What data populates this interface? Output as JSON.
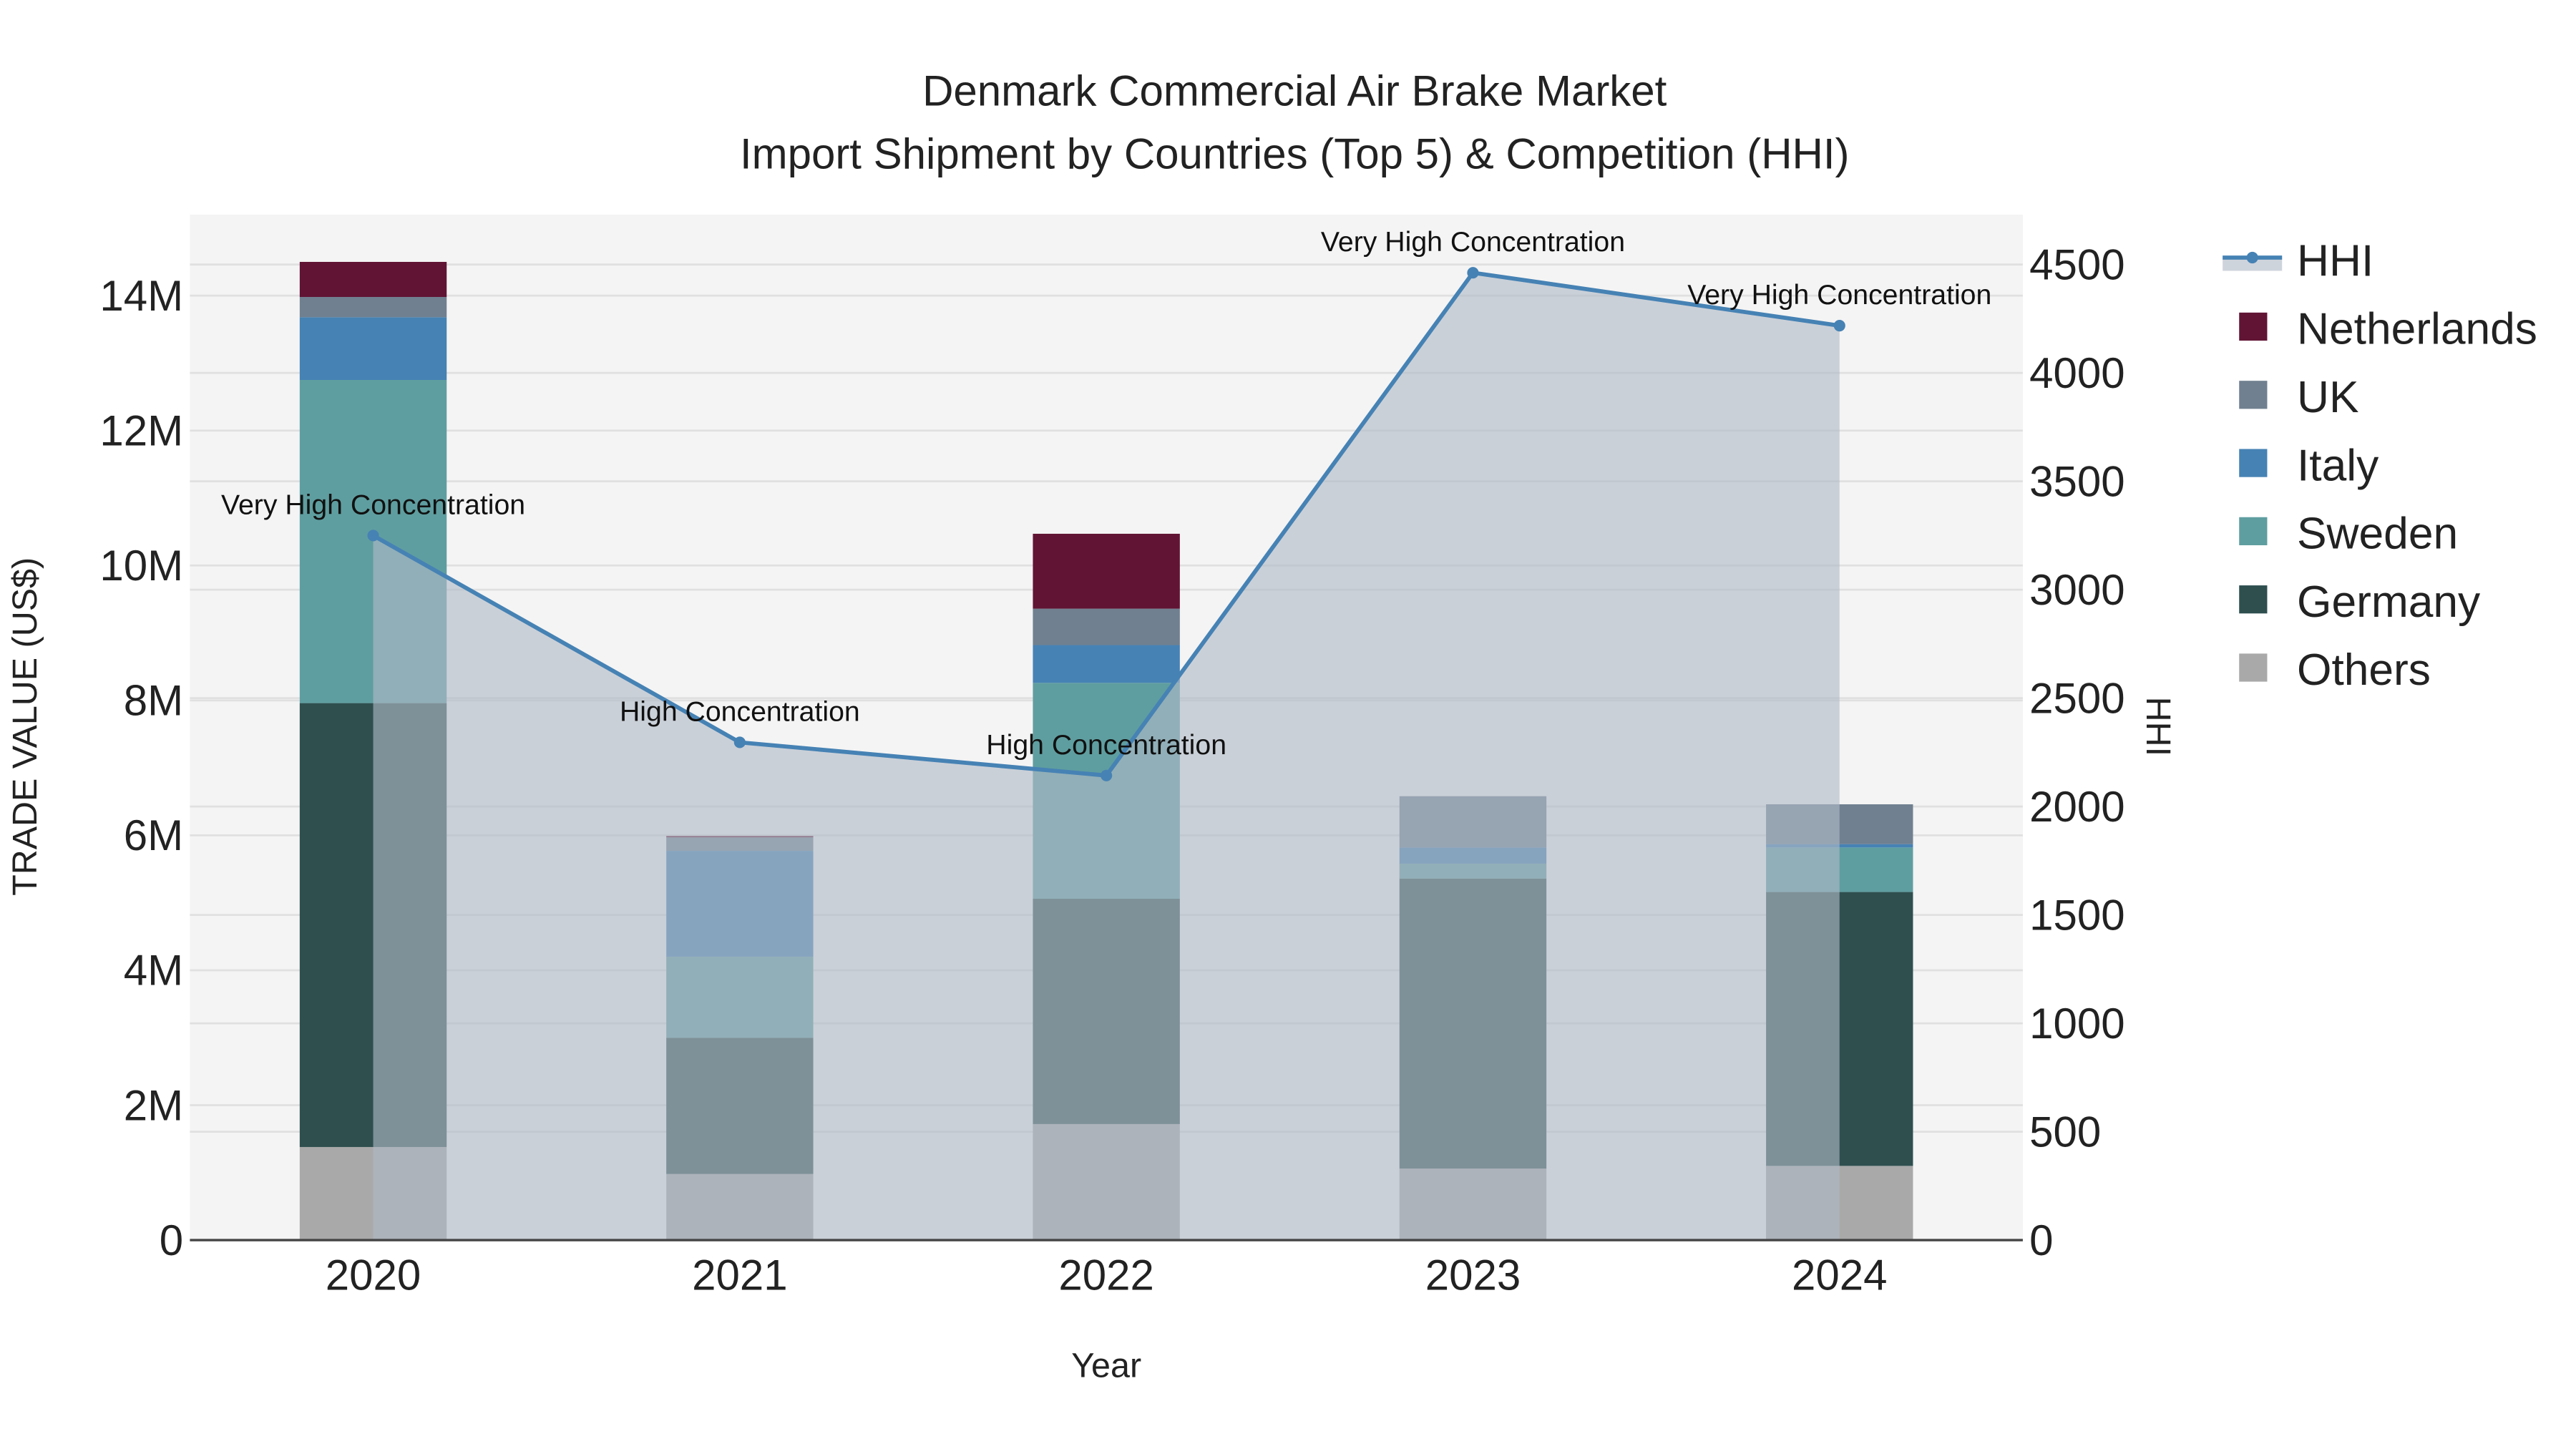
{
  "chart_data": {
    "type": "bar",
    "title_line1": "Denmark Commercial Air Brake Market",
    "title_line2": "Import Shipment by Countries (Top 5) & Competition (HHI)",
    "xlabel": "Year",
    "ylabel": "TRADE VALUE (US$)",
    "y2label": "HHI",
    "categories": [
      "2020",
      "2021",
      "2022",
      "2023",
      "2024"
    ],
    "ylim": [
      0,
      15200000
    ],
    "y2lim": [
      0,
      4730
    ],
    "yticks": [
      0,
      2000000,
      4000000,
      6000000,
      8000000,
      10000000,
      12000000,
      14000000
    ],
    "ytick_labels": [
      "0",
      "2M",
      "4M",
      "6M",
      "8M",
      "10M",
      "12M",
      "14M"
    ],
    "y2ticks": [
      0,
      500,
      1000,
      1500,
      2000,
      2500,
      3000,
      3500,
      4000,
      4500
    ],
    "y2tick_labels": [
      "0",
      "500",
      "1000",
      "1500",
      "2000",
      "2500",
      "3000",
      "3500",
      "4000",
      "4500"
    ],
    "stack_order": [
      "Others",
      "Germany",
      "Sweden",
      "Italy",
      "UK",
      "Netherlands"
    ],
    "series": [
      {
        "name": "Others",
        "color": "#A9A9A9",
        "values": [
          1380000,
          980000,
          1720000,
          1060000,
          1100000
        ]
      },
      {
        "name": "Germany",
        "color": "#2F4F4F",
        "values": [
          6580000,
          2020000,
          3340000,
          4300000,
          4060000
        ]
      },
      {
        "name": "Sweden",
        "color": "#5F9EA0",
        "values": [
          4790000,
          1200000,
          3200000,
          220000,
          660000
        ]
      },
      {
        "name": "Italy",
        "color": "#4682B4",
        "values": [
          930000,
          1570000,
          560000,
          240000,
          50000
        ]
      },
      {
        "name": "UK",
        "color": "#708090",
        "values": [
          300000,
          200000,
          540000,
          760000,
          590000
        ]
      },
      {
        "name": "Netherlands",
        "color": "#611434",
        "values": [
          520000,
          20000,
          1110000,
          0,
          0
        ]
      }
    ],
    "hhi": {
      "name": "HHI",
      "color": "#4682B4",
      "values": [
        3250,
        2296,
        2143,
        4462,
        4218
      ],
      "labels": [
        "Very High Concentration",
        "High Concentration",
        "High Concentration",
        "Very High Concentration",
        "Very High Concentration"
      ]
    },
    "legend": [
      "HHI",
      "Netherlands",
      "UK",
      "Italy",
      "Sweden",
      "Germany",
      "Others"
    ],
    "legend_position": "right",
    "grid": true
  }
}
